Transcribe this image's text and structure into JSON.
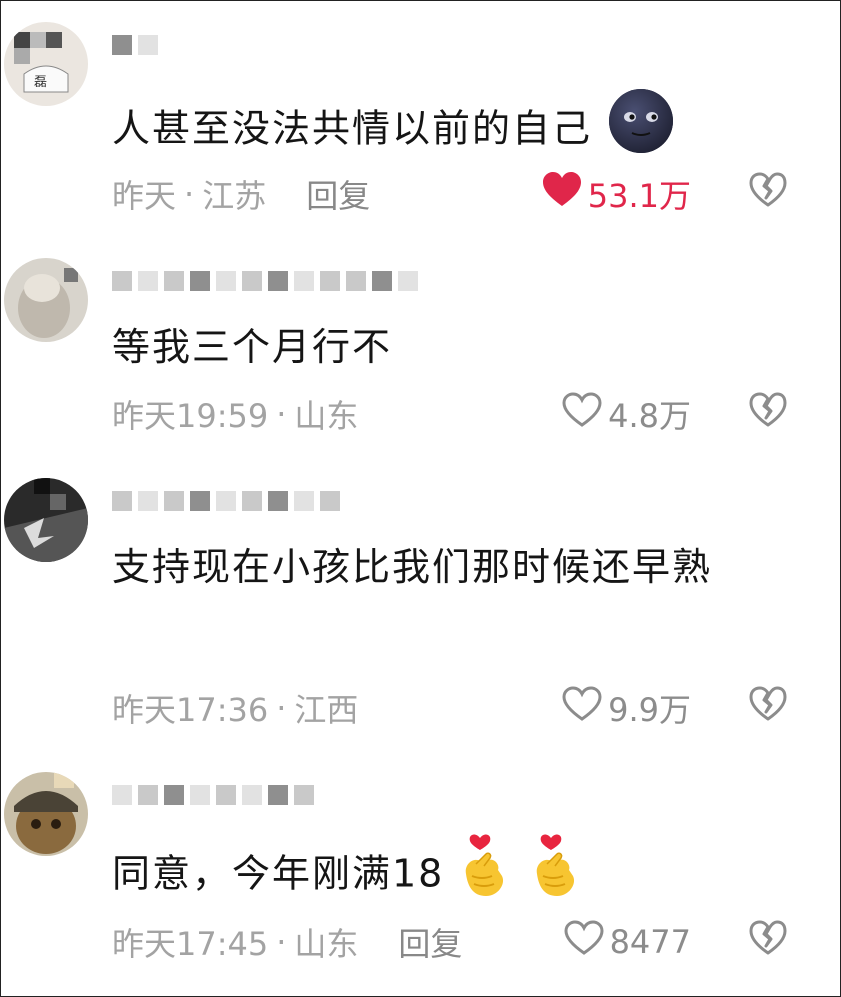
{
  "comments": [
    {
      "text": "人甚至没法共情以前的自己",
      "time": "昨天",
      "location": "江苏",
      "reply_label": "回复",
      "like_count": "53.1万",
      "liked": true,
      "emoji": "new-moon-face"
    },
    {
      "text": "等我三个月行不",
      "time": "昨天19:59",
      "location": "山东",
      "like_count": "4.8万",
      "liked": false
    },
    {
      "text": "支持现在小孩比我们那时候还早熟",
      "time": "昨天17:36",
      "location": "江西",
      "like_count": "9.9万",
      "liked": false
    },
    {
      "text": "同意，今年刚满18",
      "time": "昨天17:45",
      "location": "山东",
      "reply_label": "回复",
      "like_count": "8477",
      "liked": false,
      "emoji": "finger-heart"
    }
  ],
  "meta_separator": "·",
  "colors": {
    "text": "#151515",
    "meta": "#a3a3a3",
    "like_active": "#e0264a",
    "icon": "#8c8c8c"
  }
}
